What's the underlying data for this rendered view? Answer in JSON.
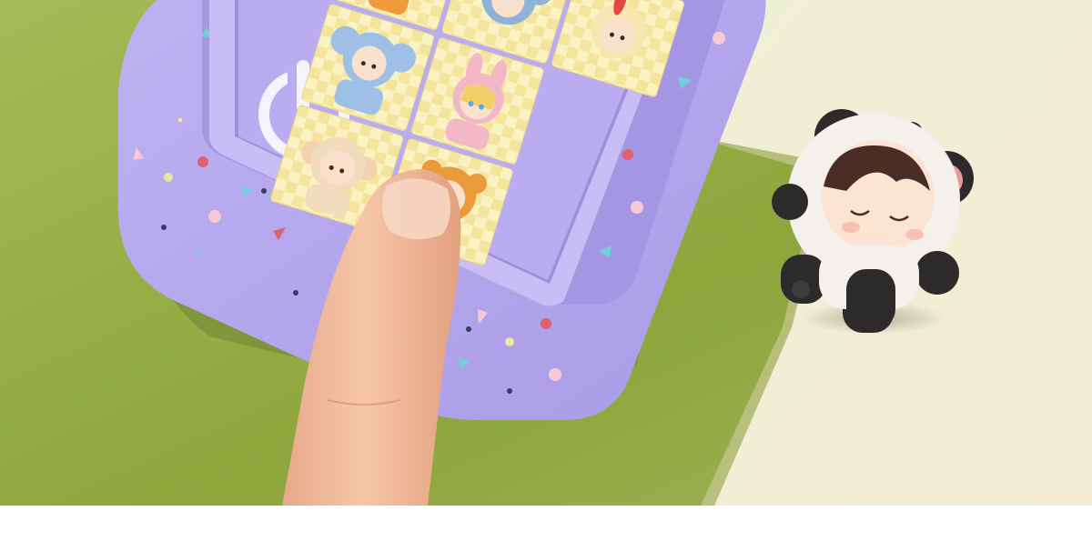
{
  "colors": {
    "green_paper": "#8fa93e",
    "green_paper_light": "#a3b957",
    "cream_paper": "#f1ebcf",
    "purple_case": "#b3a6ec",
    "purple_rim": "#a193e2",
    "purple_inner": "#c4b8f4",
    "tile_yellow": "#f6e9a8",
    "tile_cream": "#fbf3cc",
    "skin": "#f3b99a",
    "panda_white": "#f4f0ec",
    "panda_black": "#2c2a2b",
    "bottom_strip": "#ffffff"
  },
  "tiles": [
    {
      "costume": "fox-orange"
    },
    {
      "costume": "koala-blue"
    },
    {
      "costume": "bunny-yellow"
    },
    {
      "costume": "koala-blue"
    },
    {
      "costume": "bunny-pink"
    },
    {
      "costume": "monkey-cream"
    },
    {
      "costume": "bear-orange"
    }
  ],
  "icons": [
    "power-icon"
  ],
  "figurine": {
    "costume": "panda"
  }
}
